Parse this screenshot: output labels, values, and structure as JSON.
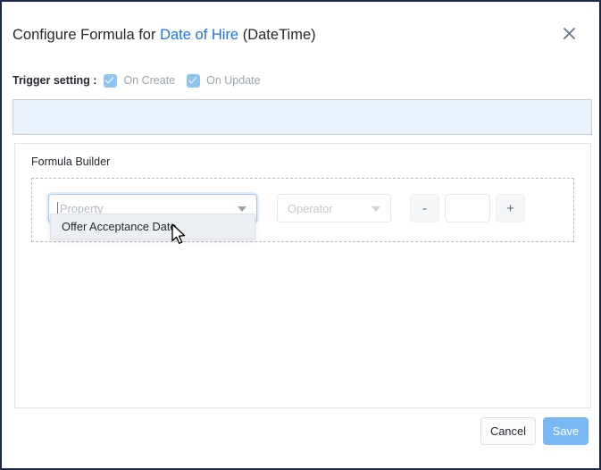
{
  "dialog": {
    "title_prefix": "Configure Formula for",
    "field_name": "Date of Hire",
    "field_type": "(DateTime)",
    "close_icon": "close-icon",
    "accent_color": "#1a73e8",
    "save_color": "#79b8f3"
  },
  "trigger": {
    "label": "Trigger setting :",
    "options": [
      {
        "label": "On Create",
        "checked": true
      },
      {
        "label": "On Update",
        "checked": true
      }
    ]
  },
  "formula_display": {
    "value": "",
    "background": "#eaf2fb"
  },
  "builder": {
    "label": "Formula Builder",
    "property_select": {
      "placeholder": "Property",
      "value": "",
      "caret_icon": "text-caret-icon",
      "arrow_icon": "chevron-down-icon"
    },
    "operator_select": {
      "placeholder": "Operator",
      "value": "",
      "arrow_icon": "chevron-down-icon"
    },
    "stepper": {
      "minus_label": "-",
      "plus_label": "+",
      "value": ""
    }
  },
  "dropdown": {
    "items": [
      {
        "label": "Offer Acceptance Date",
        "highlighted": true
      }
    ]
  },
  "footer": {
    "cancel_label": "Cancel",
    "save_label": "Save"
  },
  "cursor": {
    "icon": "mouse-pointer-icon"
  }
}
